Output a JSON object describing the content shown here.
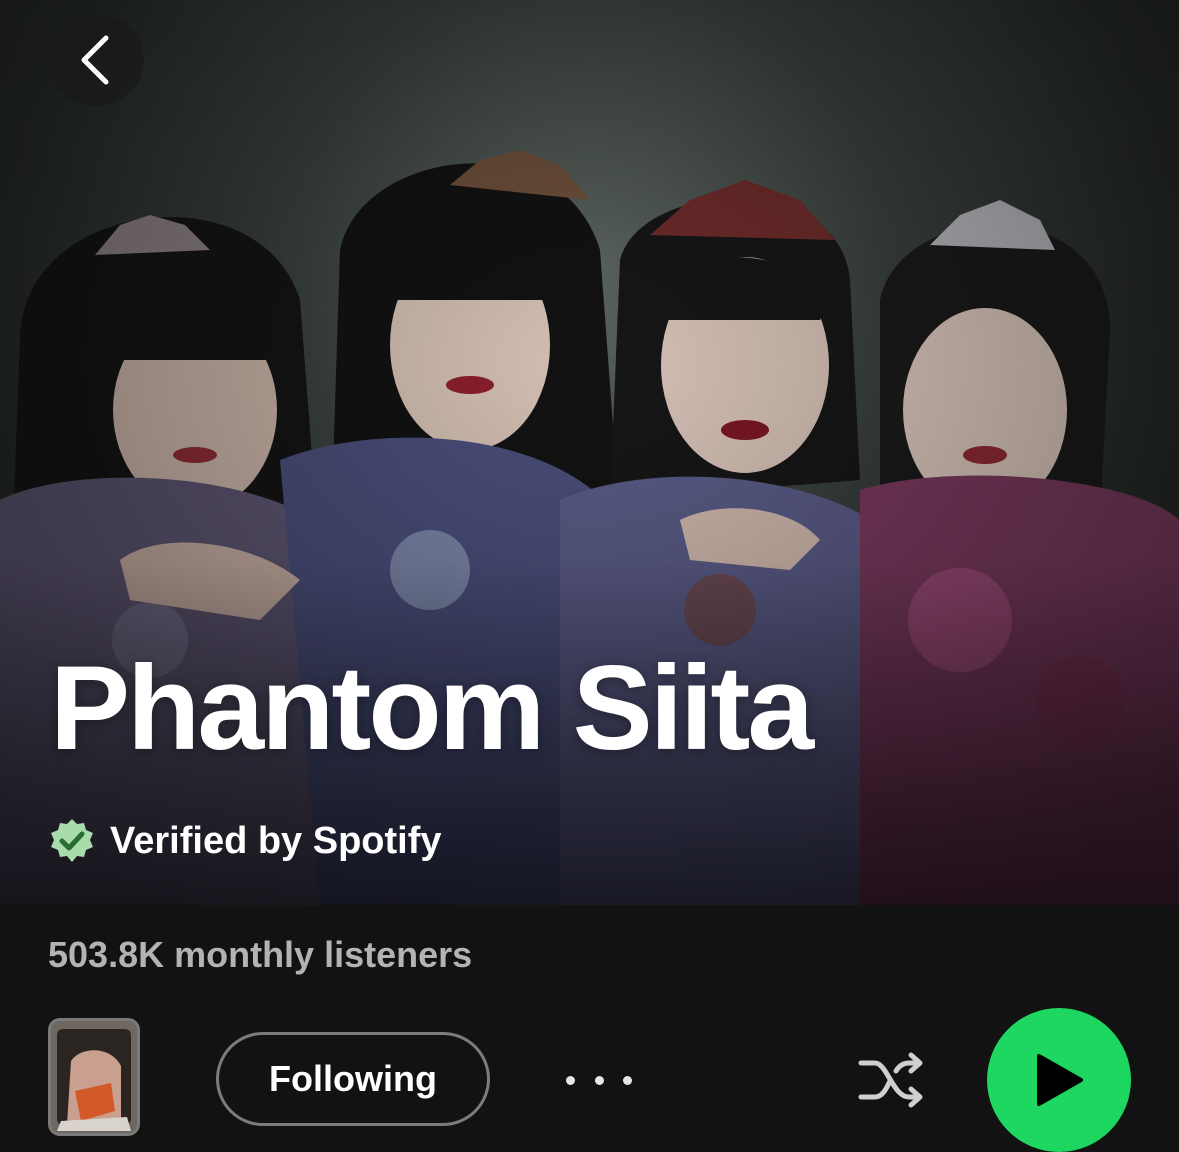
{
  "artist": {
    "name": "Phantom Siita",
    "verified_label": "Verified by Spotify",
    "monthly_listeners": "503.8K monthly listeners"
  },
  "actions": {
    "follow_label": "Following"
  },
  "icons": {
    "back": "chevron-left-icon",
    "verified": "verified-badge-icon",
    "more": "more-options-icon",
    "shuffle": "shuffle-icon",
    "play": "play-icon"
  },
  "colors": {
    "background": "#121212",
    "accent_green": "#1ed760",
    "verified_badge": "#a8dcab",
    "muted_text": "#b3b3b3"
  }
}
